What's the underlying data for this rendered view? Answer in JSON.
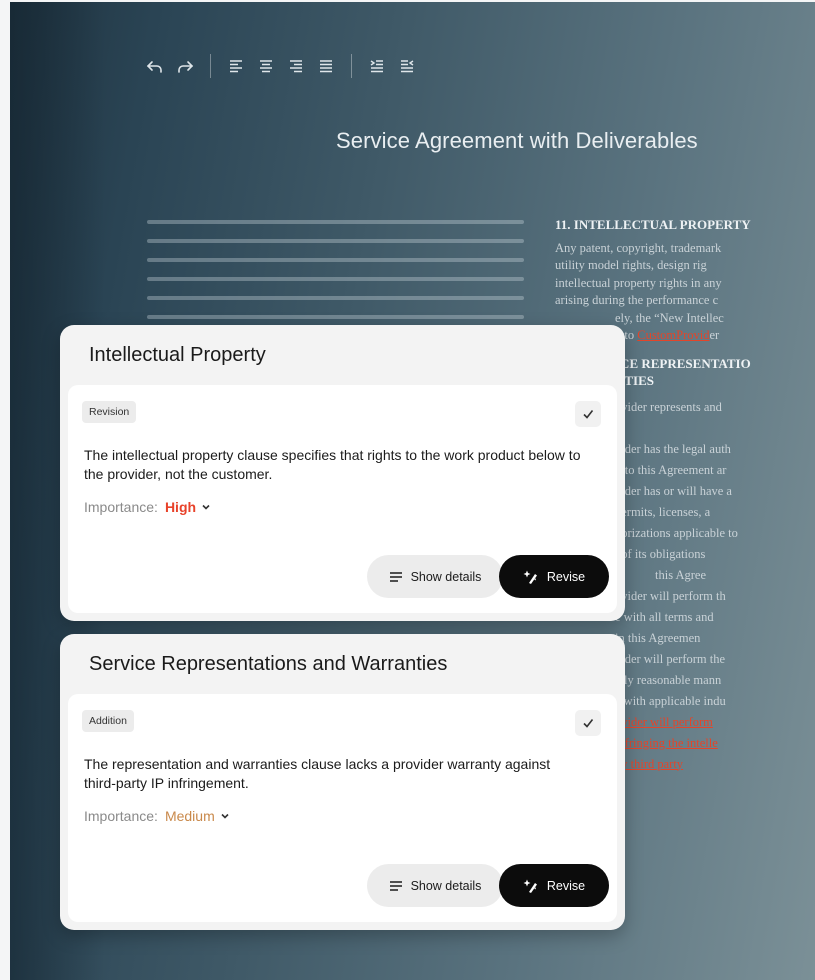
{
  "document": {
    "title": "Service Agreement with Deliverables",
    "section11": {
      "heading": "11. INTELLECTUAL PROPERTY",
      "lines": [
        "Any patent, copyright, trademark",
        "utility model rights, design rig",
        "intellectual property rights in any",
        "arising during the performance c",
        "ely, the “New Intellec"
      ],
      "last_prefix": "g to ",
      "last_deleted": "Custom",
      "last_inserted": "Provid",
      "last_suffix": "er"
    },
    "section12": {
      "heading_line1": "ICE REPRESENTATIO",
      "heading_line2": "NTIES",
      "lines": [
        "ovider represents and",
        "",
        "vider has the legal auth",
        "into this Agreement ar",
        "vider has or will have a",
        "permits, licenses, a",
        "horizations applicable to",
        "performance of its obligations",
        "this Agree",
        "ovider will perform th",
        "e with all terms and",
        "in this Agreemen",
        "vider will perform the",
        "ally reasonable mann",
        "e with applicable indu"
      ],
      "inserted_lines": [
        "ovider will perform",
        "infringing the intelle",
        "ny third party"
      ]
    }
  },
  "cards": [
    {
      "title": "Intellectual Property",
      "badge": "Revision",
      "description": "The intellectual property clause specifies that rights to the work product below to the provider, not the customer.",
      "importance_label": "Importance:",
      "importance_value": "High",
      "details_label": "Show details",
      "revise_label": "Revise"
    },
    {
      "title": "Service Representations and Warranties",
      "badge": "Addition",
      "description": "The representation and warranties clause lacks a provider warranty against third-party IP infringement.",
      "importance_label": "Importance:",
      "importance_value": "Medium",
      "details_label": "Show details",
      "revise_label": "Revise"
    }
  ],
  "icons": {
    "toolbar": [
      "undo-icon",
      "redo-icon",
      "align-left-icon",
      "align-center-icon",
      "align-right-icon",
      "align-justify-icon",
      "indent-icon",
      "outdent-icon"
    ],
    "card": [
      "check-icon",
      "chevron-down-icon",
      "lines-icon",
      "sparkle-edit-icon"
    ]
  },
  "colors": {
    "high": "#e8422a",
    "medium": "#c9894b",
    "redline": "#e3452a",
    "revise_button": "#0c0c0c"
  }
}
